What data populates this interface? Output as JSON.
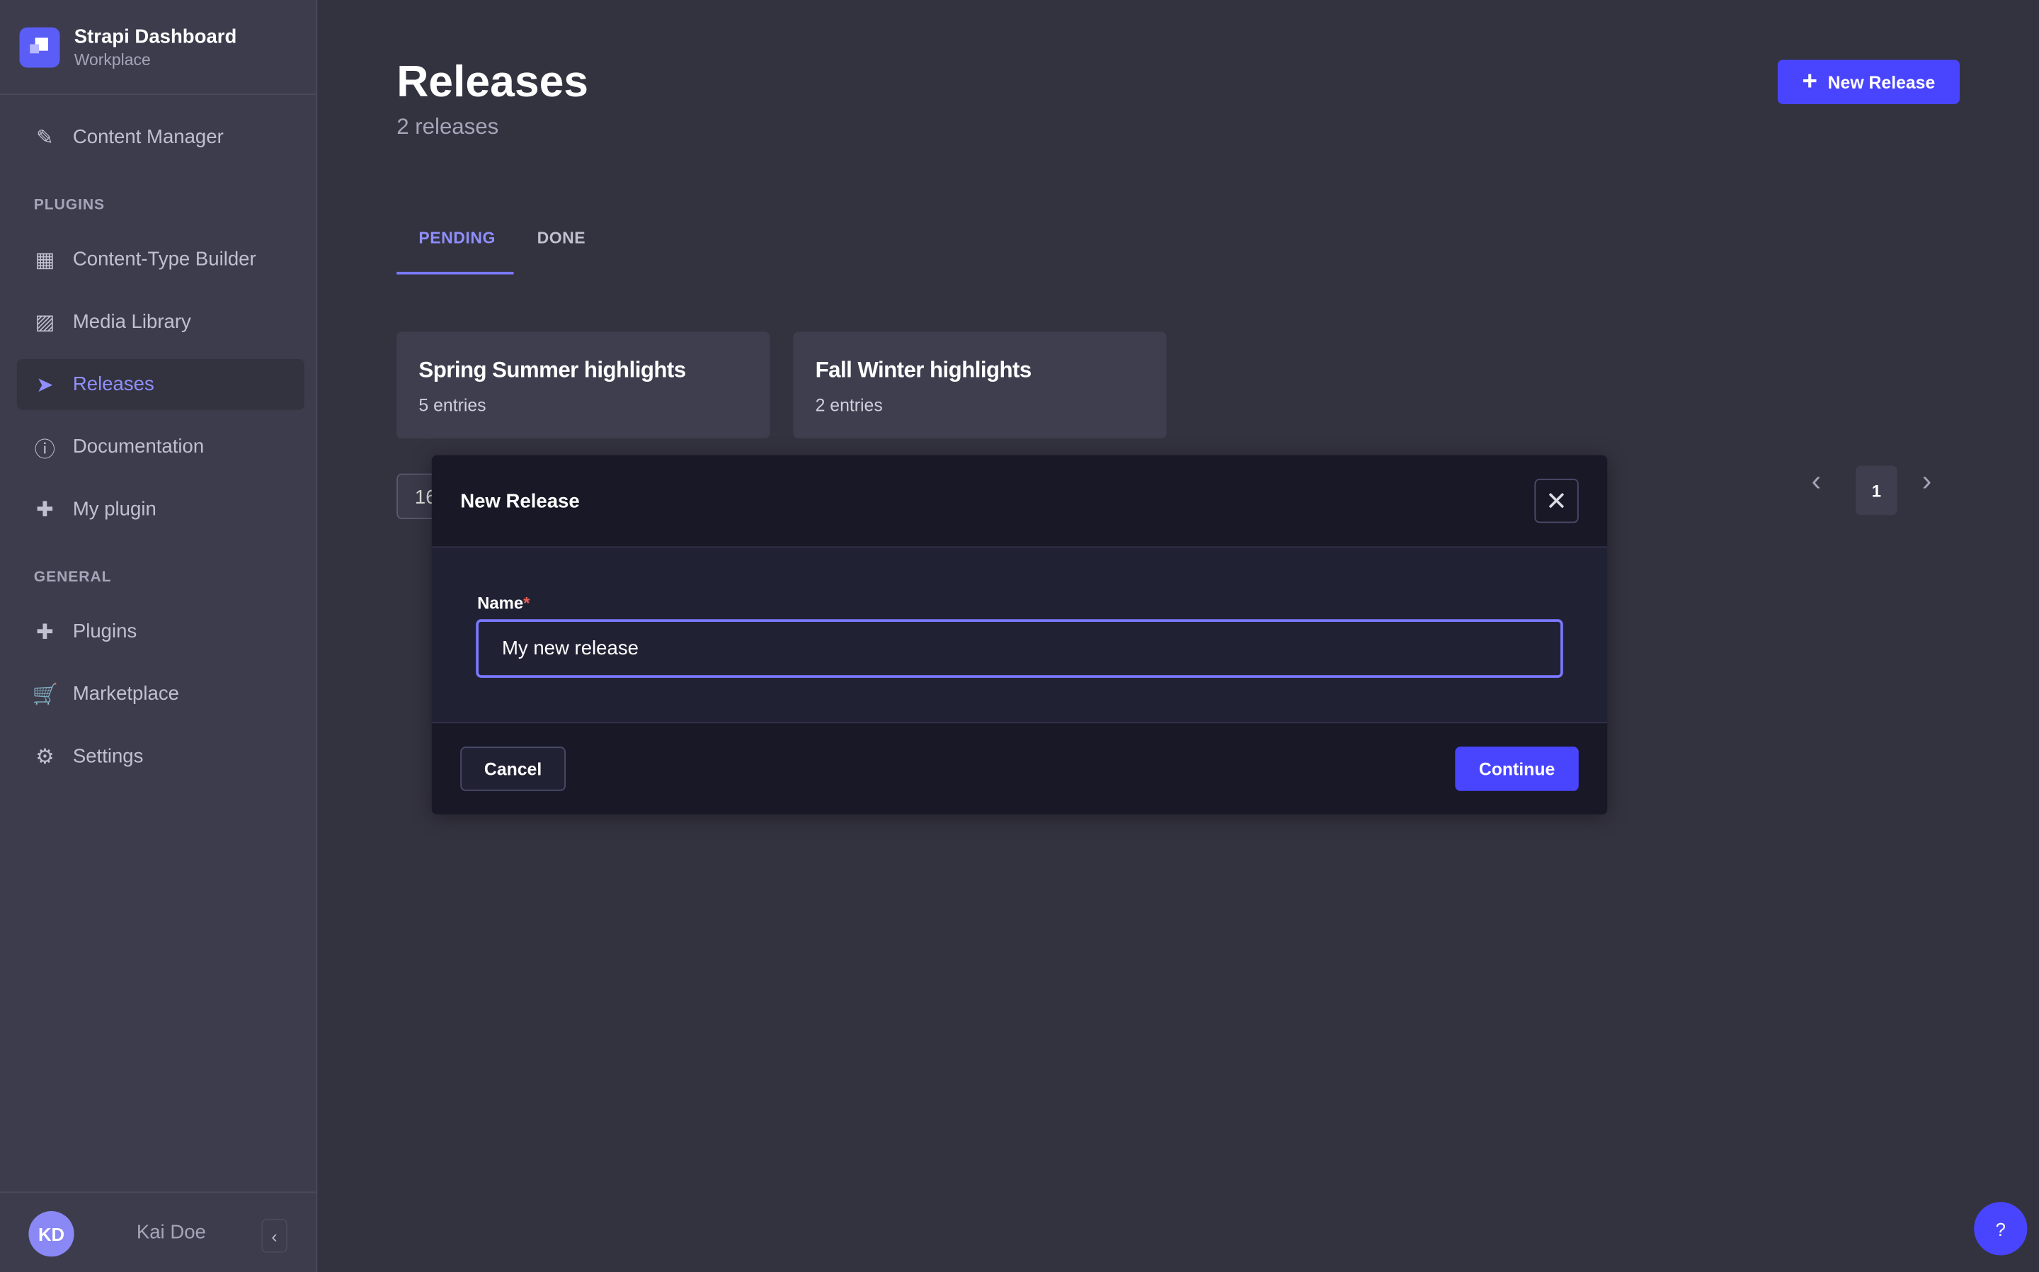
{
  "brand": {
    "title": "Strapi Dashboard",
    "subtitle": "Workplace"
  },
  "sidebar": {
    "items": [
      {
        "label": "Content Manager",
        "icon": "feather-icon"
      },
      {
        "label": "Content-Type Builder",
        "icon": "layout-icon"
      },
      {
        "label": "Media Library",
        "icon": "images-icon"
      },
      {
        "label": "Releases",
        "icon": "paper-plane-icon",
        "active": true
      },
      {
        "label": "Documentation",
        "icon": "info-icon"
      },
      {
        "label": "My plugin",
        "icon": "puzzle-icon"
      },
      {
        "label": "Plugins",
        "icon": "puzzle-icon"
      },
      {
        "label": "Marketplace",
        "icon": "cart-icon"
      },
      {
        "label": "Settings",
        "icon": "gear-icon"
      }
    ],
    "sections": {
      "plugins": "PLUGINS",
      "general": "GENERAL"
    },
    "user": {
      "initials": "KD",
      "name": "Kai Doe"
    }
  },
  "header": {
    "title": "Releases",
    "count": "2 releases",
    "new_button": "New Release"
  },
  "tabs": [
    {
      "label": "PENDING",
      "active": true
    },
    {
      "label": "DONE"
    }
  ],
  "releases": [
    {
      "name": "Spring Summer highlights",
      "entries": "5 entries"
    },
    {
      "name": "Fall Winter highlights",
      "entries": "2 entries"
    }
  ],
  "pagination": {
    "page_size": "16",
    "current": "1"
  },
  "modal": {
    "title": "New Release",
    "field_label": "Name",
    "required_mark": "*",
    "field_value": "My new release",
    "cancel": "Cancel",
    "continue": "Continue"
  },
  "help": "?",
  "colors": {
    "accent": "#4945ff",
    "active_text": "#8f8ffc"
  }
}
